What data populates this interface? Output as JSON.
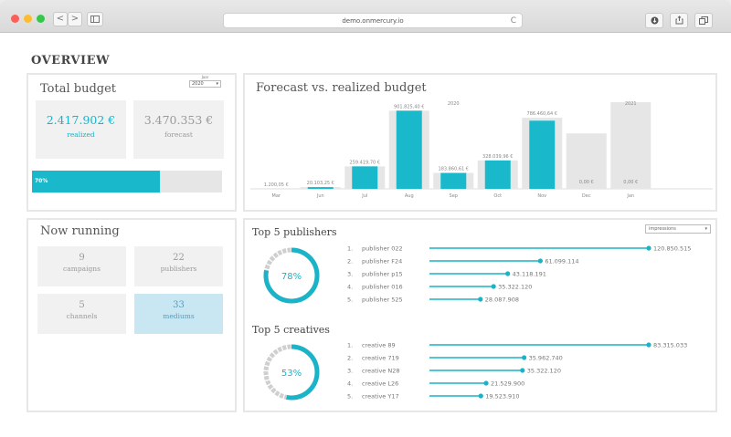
{
  "browser": {
    "url": "demo.onmercury.io",
    "back": "<",
    "forward": ">",
    "reload": "C"
  },
  "page": {
    "title": "OVERVIEW"
  },
  "total_budget": {
    "title": "Total budget",
    "year_label": "Jaar",
    "year_value": "2020",
    "realized_value": "2.417.902 €",
    "realized_label": "realized",
    "forecast_value": "3.470.353 €",
    "forecast_label": "forecast",
    "progress_label": "70%",
    "progress": 0.7,
    "colors": {
      "accent": "#1ab8cb",
      "muted": "#e6e6e6"
    }
  },
  "now_running": {
    "title": "Now running",
    "tiles": [
      {
        "value": "9",
        "label": "campaigns",
        "selected": false
      },
      {
        "value": "22",
        "label": "publishers",
        "selected": false
      },
      {
        "value": "5",
        "label": "channels",
        "selected": false
      },
      {
        "value": "33",
        "label": "mediums",
        "selected": true
      }
    ]
  },
  "forecast_chart": {
    "title": "Forecast vs. realized budget",
    "chart_data": {
      "type": "bar",
      "title": "Forecast vs. realized budget",
      "categories": [
        "Mar",
        "Jun",
        "Jul",
        "Aug",
        "Sep",
        "Oct",
        "Nov",
        "Dec",
        "Jan"
      ],
      "year_labels": [
        {
          "year": "2020",
          "category": "Sep"
        },
        {
          "year": "2021",
          "category": "Jan"
        }
      ],
      "series": [
        {
          "name": "realized",
          "values": [
            1200,
            20100,
            259419,
            901825,
            183860,
            328039,
            786460,
            0,
            0
          ],
          "color": "#1ab8cb"
        },
        {
          "name": "forecast",
          "values": [
            1200,
            20100,
            259419,
            901825,
            183860,
            328039,
            820000,
            640000,
            1000000
          ],
          "color": "#e6e6e6"
        }
      ],
      "value_labels": [
        "1.200,05 €",
        "20.103,25 €",
        "259.419,70 €",
        "901.825,40 €",
        "183.860,61 €",
        "328.039,96 €",
        "786.460,64 €",
        "0,00 €",
        "0,00 €"
      ],
      "ylim": [
        0,
        1000000
      ],
      "grid": false,
      "legend": "none"
    }
  },
  "top_publishers": {
    "title": "Top 5 publishers",
    "metric_select": "impressions",
    "percent": "78%",
    "percent_value": 0.78,
    "chart_data": {
      "type": "bar",
      "orientation": "horizontal",
      "categories": [
        "publisher 022",
        "publisher F24",
        "publisher p15",
        "publisher 016",
        "publisher 525"
      ],
      "ranks": [
        "1.",
        "2.",
        "3.",
        "4.",
        "5."
      ],
      "values": [
        120850515,
        61099114,
        43118191,
        35322120,
        28087908
      ],
      "value_labels": [
        "120.850.515",
        "61.099.114",
        "43.118.191",
        "35.322.120",
        "28.087.908"
      ]
    }
  },
  "top_creatives": {
    "title": "Top 5 creatives",
    "percent": "53%",
    "percent_value": 0.53,
    "chart_data": {
      "type": "bar",
      "orientation": "horizontal",
      "categories": [
        "creative 89",
        "creative 719",
        "creative N28",
        "creative L26",
        "creative Y17"
      ],
      "ranks": [
        "1.",
        "2.",
        "3.",
        "4.",
        "5."
      ],
      "values": [
        83315033,
        35962740,
        35322120,
        21529900,
        19523910
      ],
      "value_labels": [
        "83.315.033",
        "35.962.740",
        "35.322.120",
        "21.529.900",
        "19.523.910"
      ]
    }
  }
}
